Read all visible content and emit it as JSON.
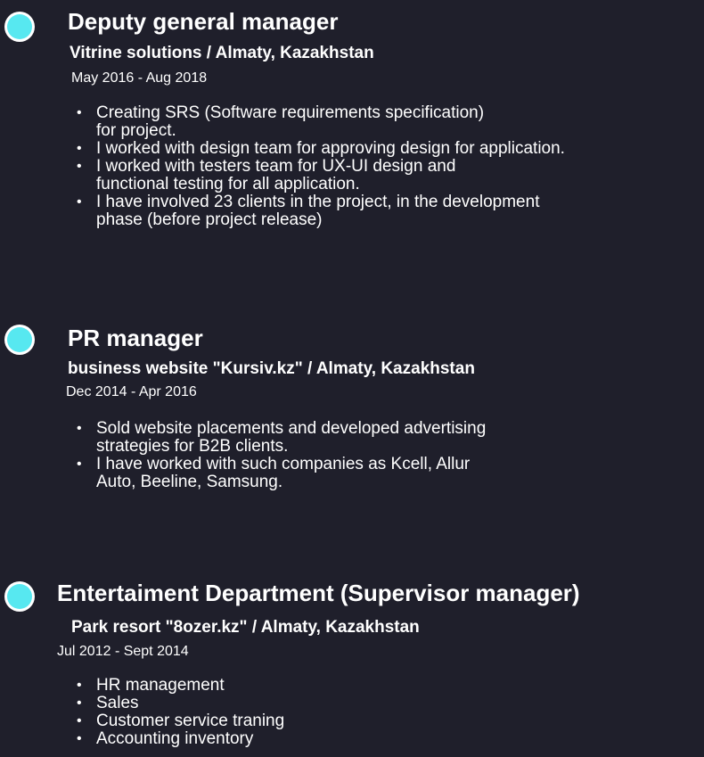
{
  "accent_color": "#57e8f0",
  "background_color": "#1f1f2b",
  "jobs": [
    {
      "title": "Deputy general manager",
      "company": "Vitrine solutions / Almaty, Kazakhstan",
      "period": "May 2016 - Aug 2018",
      "duties": [
        "Creating SRS (Software requirements specification) for project.",
        "I worked with design team for approving design for application.",
        "I worked with testers team for UX-UI design and functional testing for all application.",
        "I have involved 23 clients in the project, in the development phase (before project release)"
      ]
    },
    {
      "title": "PR manager",
      "company": "business website \"Kursiv.kz\" / Almaty, Kazakhstan",
      "period": "Dec 2014 - Apr 2016",
      "duties": [
        "Sold website placements and developed advertising strategies for B2B clients.",
        "I have worked with such companies as Kcell, Allur Auto, Beeline, Samsung."
      ]
    },
    {
      "title": "Entertaiment Department (Supervisor manager)",
      "company": "Park resort \"8ozer.kz\" / Almaty, Kazakhstan",
      "period": "Jul 2012 - Sept 2014",
      "duties": [
        "HR management",
        "Sales",
        "Customer service traning",
        "Accounting inventory"
      ]
    }
  ]
}
